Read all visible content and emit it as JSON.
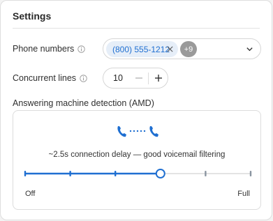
{
  "settings": {
    "title": "Settings",
    "phone_numbers": {
      "label": "Phone numbers",
      "chip": "(800) 555-1212",
      "more_count": "+9"
    },
    "concurrent_lines": {
      "label": "Concurrent lines",
      "value": "10"
    },
    "amd": {
      "label": "Answering machine detection (AMD)",
      "description": "~2.5s connection delay — good voicemail filtering",
      "slider_min_label": "Off",
      "slider_max_label": "Full",
      "slider_steps": 6,
      "slider_value_index": 3
    }
  },
  "colors": {
    "accent": "#1f6fd1",
    "track": "#e3e3e3",
    "tick_inactive": "#8a94a0"
  }
}
